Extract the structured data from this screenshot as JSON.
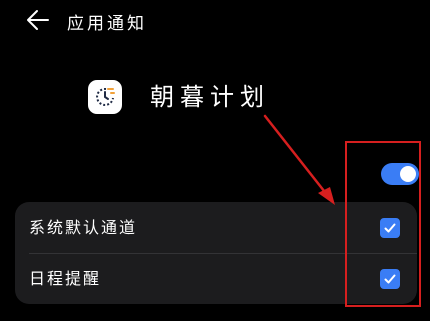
{
  "header": {
    "back_icon": "arrow-left-icon",
    "title": "应用通知"
  },
  "app": {
    "icon": "app-logo-icon",
    "name": "朝暮计划"
  },
  "master_toggle": {
    "state": "on",
    "color": "#3a7df5"
  },
  "channels": [
    {
      "label": "系统默认通道",
      "checked": true
    },
    {
      "label": "日程提醒",
      "checked": true
    }
  ],
  "annotation": {
    "color": "#d61f1f"
  },
  "colors": {
    "background": "#000000",
    "card": "#1c1c1e",
    "accent": "#3a7df5"
  }
}
